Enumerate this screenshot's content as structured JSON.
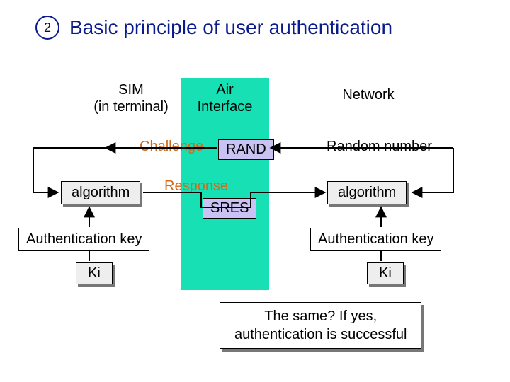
{
  "badge": "2",
  "title": "Basic principle of user authentication",
  "heads": {
    "sim1": "SIM",
    "sim2": "(in terminal)",
    "air1": "Air",
    "air2": "Interface",
    "net": "Network"
  },
  "labels": {
    "challenge": "Challenge",
    "rand": "RAND",
    "response": "Response",
    "sres": "SRES",
    "random_number": "Random number"
  },
  "boxes": {
    "algorithm_left": "algorithm",
    "algorithm_right": "algorithm",
    "authkey_left": "Authentication key",
    "authkey_right": "Authentication key",
    "ki_left": "Ki",
    "ki_right": "Ki",
    "result": "The same?  If yes,\nauthentication is successful"
  }
}
